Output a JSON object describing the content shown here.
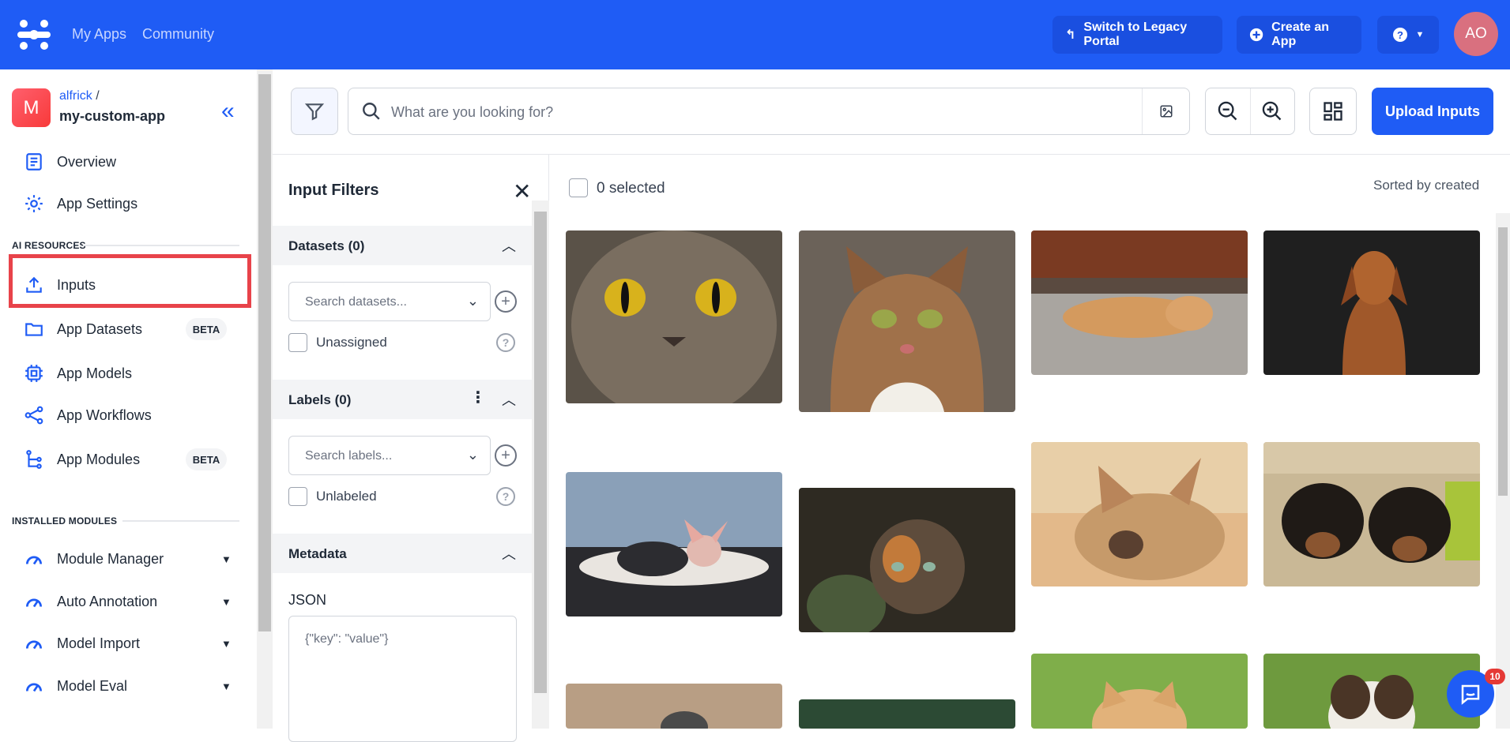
{
  "topbar": {
    "nav": [
      "My Apps",
      "Community"
    ],
    "legacy_label": "Switch to Legacy Portal",
    "create_label": "Create an App",
    "avatar_initials": "AO",
    "brand_color": "#1f5cf5"
  },
  "sidebar": {
    "app_avatar_letter": "M",
    "owner": "alfrick",
    "owner_sep": "/",
    "app_name": "my-custom-app",
    "items_top": [
      {
        "label": "Overview",
        "icon": "document-icon"
      },
      {
        "label": "App Settings",
        "icon": "gear-icon"
      }
    ],
    "section_ai": "AI RESOURCES",
    "ai_items": [
      {
        "label": "Inputs",
        "icon": "upload-icon",
        "badge": ""
      },
      {
        "label": "App Datasets",
        "icon": "folder-icon",
        "badge": "BETA"
      },
      {
        "label": "App Models",
        "icon": "chip-icon",
        "badge": ""
      },
      {
        "label": "App Workflows",
        "icon": "share-icon",
        "badge": ""
      },
      {
        "label": "App Modules",
        "icon": "tree-icon",
        "badge": "BETA"
      }
    ],
    "section_modules": "INSTALLED MODULES",
    "modules": [
      "Module Manager",
      "Auto Annotation",
      "Model Import",
      "Model Eval"
    ]
  },
  "toolbar": {
    "search_placeholder": "What are you looking for?",
    "upload_label": "Upload Inputs"
  },
  "filters": {
    "title": "Input Filters",
    "datasets_header": "Datasets (0)",
    "datasets_placeholder": "Search datasets...",
    "unassigned_label": "Unassigned",
    "labels_header": "Labels (0)",
    "labels_placeholder": "Search labels...",
    "unlabeled_label": "Unlabeled",
    "metadata_header": "Metadata",
    "json_label": "JSON",
    "json_placeholder": "{\"key\": \"value\"}"
  },
  "grid": {
    "selected_label": "0 selected",
    "sorted_label": "Sorted by created",
    "images": [
      "cat-closeup-yellow-eyes",
      "tabby-cat-green-eyes",
      "sleeping-orange-kitten",
      "brown-dog-dark-background",
      "sphynx-cat-in-sweater",
      "calico-cat-dark-forest",
      "french-bulldog-lying",
      "two-rottweiler-puppies",
      "cat-near-wooden-wall",
      "green-dark-image",
      "ginger-cat-on-grass",
      "puppy-on-grass"
    ]
  },
  "chat": {
    "badge_count": "10"
  }
}
